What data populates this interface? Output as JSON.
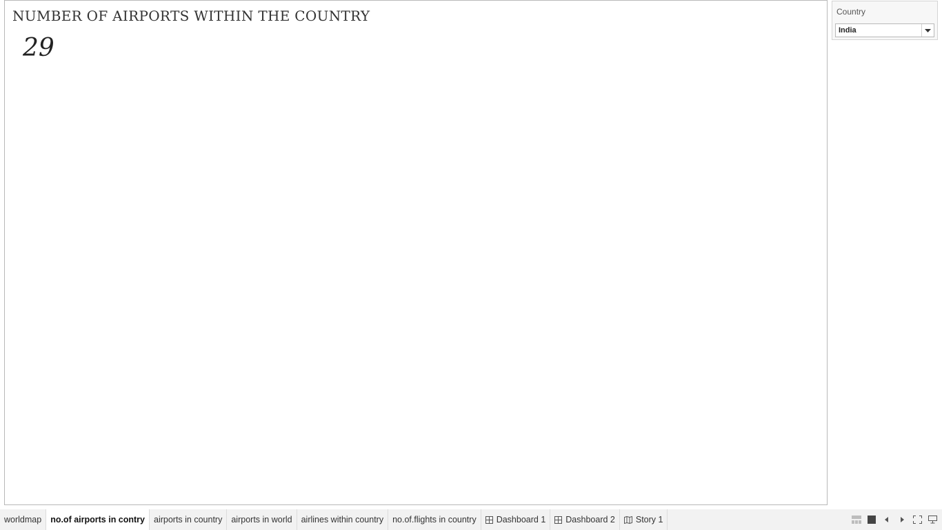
{
  "sheet": {
    "title": "NUMBER OF AIRPORTS WITHIN THE COUNTRY",
    "value": "29"
  },
  "filter": {
    "title": "Country",
    "selected": "India"
  },
  "tabs": [
    {
      "label": "worldmap",
      "icon": "",
      "active": false
    },
    {
      "label": "no.of airports in contry",
      "icon": "",
      "active": true
    },
    {
      "label": "airports in country",
      "icon": "",
      "active": false
    },
    {
      "label": "airports in world",
      "icon": "",
      "active": false
    },
    {
      "label": "airlines within country",
      "icon": "",
      "active": false
    },
    {
      "label": "no.of.flights in country",
      "icon": "",
      "active": false
    },
    {
      "label": "Dashboard 1",
      "icon": "dashboard-icon",
      "active": false
    },
    {
      "label": "Dashboard 2",
      "icon": "dashboard-icon",
      "active": false
    },
    {
      "label": "Story 1",
      "icon": "story-icon",
      "active": false
    }
  ],
  "controls": [
    "filmstrip-icon",
    "sheet-view-icon",
    "previous-icon",
    "next-icon",
    "fullscreen-icon",
    "presentation-icon"
  ],
  "colors": {
    "border": "#b8b8b8",
    "tab_bar": "#f2f2f2",
    "active_tab": "#ffffff"
  }
}
